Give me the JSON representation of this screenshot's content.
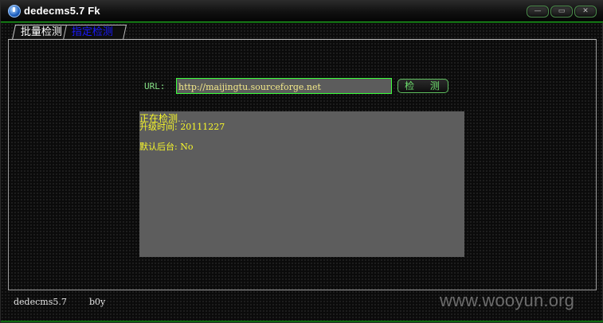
{
  "window": {
    "title": "dedecms5.7 Fk"
  },
  "window_controls": [
    {
      "name": "minimize",
      "glyph": "—"
    },
    {
      "name": "maximize",
      "glyph": "▭"
    },
    {
      "name": "close",
      "glyph": "✕"
    }
  ],
  "tabs": [
    {
      "label": "批量检测",
      "active": false
    },
    {
      "label": "指定检测",
      "active": true
    }
  ],
  "form": {
    "url_label": "URL:",
    "url_value": "http://maijingtu.sourceforge.net",
    "check_button": "检 测"
  },
  "output": {
    "status": "正在检测",
    "status_dots": "...",
    "upgrade_line": "升级时间: 20111227",
    "admin_line": "默认后台: No"
  },
  "statusbar": {
    "version": "dedecms5.7",
    "author": "b0y"
  },
  "watermark": "www.wooyun.org",
  "colors": {
    "accent_green": "#3cff3c",
    "output_text": "#f7f72a",
    "output_bg": "#5d5d5d"
  }
}
